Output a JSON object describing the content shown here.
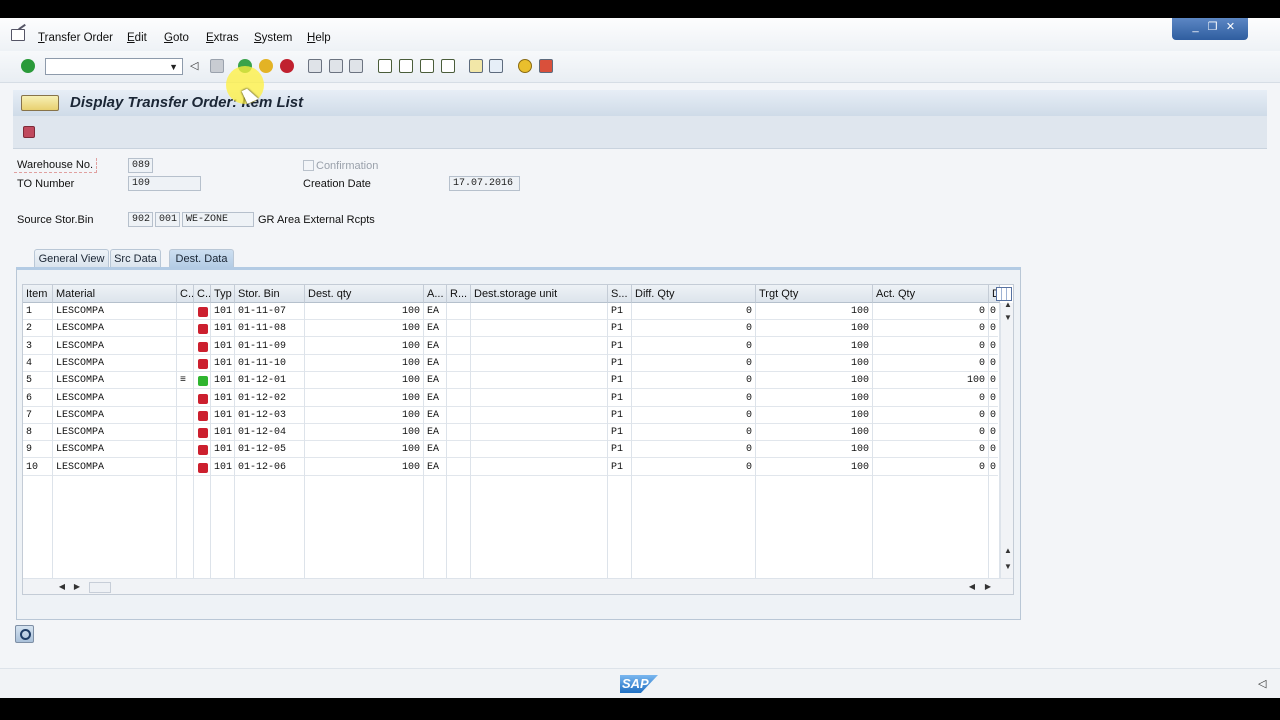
{
  "menu": {
    "items": [
      "Transfer Order",
      "Edit",
      "Goto",
      "Extras",
      "System",
      "Help"
    ]
  },
  "toolbar": {
    "command_field_value": "",
    "icons": [
      "enter-icon",
      "back-icon",
      "save-icon",
      "exit-icon",
      "cancel-icon",
      "print-icon",
      "find-icon",
      "find-next-icon",
      "first-page-icon",
      "previous-page-icon",
      "next-page-icon",
      "last-page-icon",
      "create-session-icon",
      "shortcut-icon",
      "help-icon",
      "layout-icon"
    ]
  },
  "window_controls": [
    "_",
    "❐",
    "✕"
  ],
  "title": "Display Transfer Order: Item List",
  "header": {
    "warehouse_label": "Warehouse No.",
    "warehouse_value": "089",
    "to_number_label": "TO Number",
    "to_number_value": "109",
    "confirmation_label": "Confirmation",
    "confirmation_checked": false,
    "creation_date_label": "Creation Date",
    "creation_date_value": "17.07.2016",
    "source_bin_label": "Source Stor.Bin",
    "source_type": "902",
    "source_section": "001",
    "source_bin": "WE-ZONE",
    "source_bin_desc": "GR Area External Rcpts"
  },
  "tabs": [
    {
      "label": "General View",
      "active": false
    },
    {
      "label": "Src Data",
      "active": false
    },
    {
      "label": "Dest. Data",
      "active": true
    }
  ],
  "table": {
    "columns": [
      "Item",
      "Material",
      "C..",
      "C..",
      "Typ",
      "Stor. Bin",
      "Dest. qty",
      "A...",
      "R...",
      "Dest.storage unit",
      "S...",
      "Diff. Qty",
      "Trgt Qty",
      "Act. Qty",
      "D"
    ],
    "rows": [
      {
        "item": "1",
        "material": "LESCOMPA",
        "c1": "",
        "status": "red",
        "typ": "101",
        "bin": "01-11-07",
        "dest_qty": "100",
        "uom": "EA",
        "r": "",
        "dsu": "",
        "s": "P1",
        "diff": "0",
        "trgt": "100",
        "act": "0",
        "d": "0"
      },
      {
        "item": "2",
        "material": "LESCOMPA",
        "c1": "",
        "status": "red",
        "typ": "101",
        "bin": "01-11-08",
        "dest_qty": "100",
        "uom": "EA",
        "r": "",
        "dsu": "",
        "s": "P1",
        "diff": "0",
        "trgt": "100",
        "act": "0",
        "d": "0"
      },
      {
        "item": "3",
        "material": "LESCOMPA",
        "c1": "",
        "status": "red",
        "typ": "101",
        "bin": "01-11-09",
        "dest_qty": "100",
        "uom": "EA",
        "r": "",
        "dsu": "",
        "s": "P1",
        "diff": "0",
        "trgt": "100",
        "act": "0",
        "d": "0"
      },
      {
        "item": "4",
        "material": "LESCOMPA",
        "c1": "",
        "status": "red",
        "typ": "101",
        "bin": "01-11-10",
        "dest_qty": "100",
        "uom": "EA",
        "r": "",
        "dsu": "",
        "s": "P1",
        "diff": "0",
        "trgt": "100",
        "act": "0",
        "d": "0"
      },
      {
        "item": "5",
        "material": "LESCOMPA",
        "c1": "≡",
        "status": "green",
        "typ": "101",
        "bin": "01-12-01",
        "dest_qty": "100",
        "uom": "EA",
        "r": "",
        "dsu": "",
        "s": "P1",
        "diff": "0",
        "trgt": "100",
        "act": "100",
        "d": "0"
      },
      {
        "item": "6",
        "material": "LESCOMPA",
        "c1": "",
        "status": "red",
        "typ": "101",
        "bin": "01-12-02",
        "dest_qty": "100",
        "uom": "EA",
        "r": "",
        "dsu": "",
        "s": "P1",
        "diff": "0",
        "trgt": "100",
        "act": "0",
        "d": "0"
      },
      {
        "item": "7",
        "material": "LESCOMPA",
        "c1": "",
        "status": "red",
        "typ": "101",
        "bin": "01-12-03",
        "dest_qty": "100",
        "uom": "EA",
        "r": "",
        "dsu": "",
        "s": "P1",
        "diff": "0",
        "trgt": "100",
        "act": "0",
        "d": "0"
      },
      {
        "item": "8",
        "material": "LESCOMPA",
        "c1": "",
        "status": "red",
        "typ": "101",
        "bin": "01-12-04",
        "dest_qty": "100",
        "uom": "EA",
        "r": "",
        "dsu": "",
        "s": "P1",
        "diff": "0",
        "trgt": "100",
        "act": "0",
        "d": "0"
      },
      {
        "item": "9",
        "material": "LESCOMPA",
        "c1": "",
        "status": "red",
        "typ": "101",
        "bin": "01-12-05",
        "dest_qty": "100",
        "uom": "EA",
        "r": "",
        "dsu": "",
        "s": "P1",
        "diff": "0",
        "trgt": "100",
        "act": "0",
        "d": "0"
      },
      {
        "item": "10",
        "material": "LESCOMPA",
        "c1": "",
        "status": "red",
        "typ": "101",
        "bin": "01-12-06",
        "dest_qty": "100",
        "uom": "EA",
        "r": "",
        "dsu": "",
        "s": "P1",
        "diff": "0",
        "trgt": "100",
        "act": "0",
        "d": "0"
      }
    ]
  },
  "status_bar": {
    "logo": "SAP"
  },
  "colors": {
    "status_red": "#cc1f2e",
    "status_green": "#2fb52f",
    "accent": "#2f5d9f"
  }
}
